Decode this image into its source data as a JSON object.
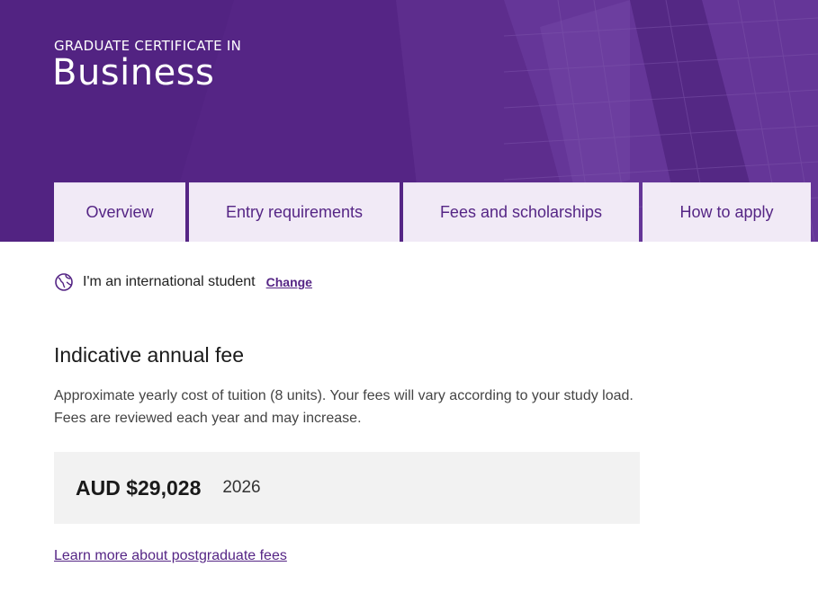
{
  "hero": {
    "eyebrow": "GRADUATE CERTIFICATE IN",
    "title": "Business"
  },
  "tabs": [
    {
      "label": "Overview"
    },
    {
      "label": "Entry requirements"
    },
    {
      "label": "Fees and scholarships"
    },
    {
      "label": "How to apply"
    }
  ],
  "student": {
    "icon": "globe-icon",
    "text": "I'm an international student",
    "change_label": "Change"
  },
  "fees": {
    "heading": "Indicative annual fee",
    "description": "Approximate yearly cost of tuition (8 units). Your fees will vary according to your study load. Fees are reviewed each year and may increase.",
    "amount": "AUD $29,028",
    "year": "2026",
    "learn_more": "Learn more about postgraduate fees"
  },
  "colors": {
    "brand_purple": "#552585",
    "tab_bg": "#f1eaf6",
    "fee_box_bg": "#f2f2f2"
  }
}
